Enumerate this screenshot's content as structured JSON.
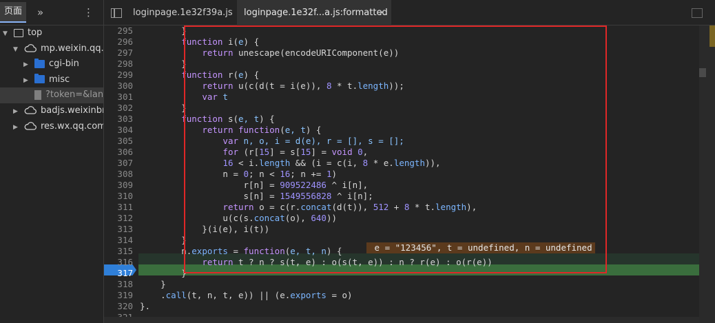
{
  "navigator": {
    "tab_label": "页面",
    "more_label": "»",
    "menu_label": "⋮",
    "tree": [
      {
        "label": "top",
        "icon": "frame-icon",
        "arrow": "▼",
        "indent": 0
      },
      {
        "label": "mp.weixin.qq.com",
        "icon": "cloud-icon",
        "arrow": "▼",
        "indent": 1
      },
      {
        "label": "cgi-bin",
        "icon": "folder-icon",
        "arrow": "▶",
        "indent": 2
      },
      {
        "label": "misc",
        "icon": "folder-icon",
        "arrow": "▶",
        "indent": 2
      },
      {
        "label": "?token=&lang",
        "icon": "file-icon",
        "arrow": "",
        "indent": 2,
        "selected": true
      },
      {
        "label": "badjs.weixinbridge",
        "icon": "cloud-icon",
        "arrow": "▶",
        "indent": 1
      },
      {
        "label": "res.wx.qq.com",
        "icon": "cloud-icon",
        "arrow": "▶",
        "indent": 1
      }
    ]
  },
  "editor_tabs": {
    "tab1": "loginpage.1e32f39a.js",
    "tab2": "loginpage.1e32f...a.js:formatted",
    "close": "×"
  },
  "code": {
    "inline_value": " e = \"123456\", t = undefined, n = undefined",
    "lines": [
      {
        "n": "295",
        "segs": [
          [
            "        }",
            "op"
          ]
        ]
      },
      {
        "n": "296",
        "segs": [
          [
            "        ",
            "op"
          ],
          [
            "function",
            "kw"
          ],
          [
            " i(",
            "fn"
          ],
          [
            "e",
            "var"
          ],
          [
            ") {",
            "op"
          ]
        ]
      },
      {
        "n": "297",
        "segs": [
          [
            "            ",
            "op"
          ],
          [
            "return",
            "kw"
          ],
          [
            " unescape(encodeURIComponent(e))",
            "fn"
          ]
        ]
      },
      {
        "n": "298",
        "segs": [
          [
            "        }",
            "op"
          ]
        ]
      },
      {
        "n": "299",
        "segs": [
          [
            "        ",
            "op"
          ],
          [
            "function",
            "kw"
          ],
          [
            " r(",
            "fn"
          ],
          [
            "e",
            "var"
          ],
          [
            ") {",
            "op"
          ]
        ]
      },
      {
        "n": "300",
        "segs": [
          [
            "            ",
            "op"
          ],
          [
            "return",
            "kw"
          ],
          [
            " u(c(d(t = i(e)), ",
            "fn"
          ],
          [
            "8",
            "num"
          ],
          [
            " * t.",
            "op"
          ],
          [
            "length",
            "prop"
          ],
          [
            "));",
            "op"
          ]
        ]
      },
      {
        "n": "301",
        "segs": [
          [
            "            ",
            "op"
          ],
          [
            "var",
            "kw"
          ],
          [
            " t",
            "var"
          ]
        ]
      },
      {
        "n": "302",
        "segs": [
          [
            "        }",
            "op"
          ]
        ]
      },
      {
        "n": "303",
        "segs": [
          [
            "        ",
            "op"
          ],
          [
            "function",
            "kw"
          ],
          [
            " s(",
            "fn"
          ],
          [
            "e, t",
            "var"
          ],
          [
            ") {",
            "op"
          ]
        ]
      },
      {
        "n": "304",
        "segs": [
          [
            "            ",
            "op"
          ],
          [
            "return",
            "kw"
          ],
          [
            " ",
            "op"
          ],
          [
            "function",
            "kw"
          ],
          [
            "(",
            "op"
          ],
          [
            "e, t",
            "var"
          ],
          [
            ") {",
            "op"
          ]
        ]
      },
      {
        "n": "305",
        "segs": [
          [
            "                ",
            "op"
          ],
          [
            "var",
            "kw"
          ],
          [
            " n, o, i = d(e), r = [], s = [];",
            "var"
          ]
        ]
      },
      {
        "n": "306",
        "segs": [
          [
            "                ",
            "op"
          ],
          [
            "for",
            "kw"
          ],
          [
            " (r[",
            "op"
          ],
          [
            "15",
            "num"
          ],
          [
            "] = s[",
            "op"
          ],
          [
            "15",
            "num"
          ],
          [
            "] = ",
            "op"
          ],
          [
            "void",
            "kw"
          ],
          [
            " ",
            "op"
          ],
          [
            "0",
            "num"
          ],
          [
            ",",
            "op"
          ]
        ]
      },
      {
        "n": "307",
        "segs": [
          [
            "                ",
            "op"
          ],
          [
            "16",
            "num"
          ],
          [
            " < i.",
            "op"
          ],
          [
            "length",
            "prop"
          ],
          [
            " && (i = c(i, ",
            "op"
          ],
          [
            "8",
            "num"
          ],
          [
            " * e.",
            "op"
          ],
          [
            "length",
            "prop"
          ],
          [
            ")),",
            "op"
          ]
        ]
      },
      {
        "n": "308",
        "segs": [
          [
            "                n = ",
            "op"
          ],
          [
            "0",
            "num"
          ],
          [
            "; n < ",
            "op"
          ],
          [
            "16",
            "num"
          ],
          [
            "; n += ",
            "op"
          ],
          [
            "1",
            "num"
          ],
          [
            ")",
            "op"
          ]
        ]
      },
      {
        "n": "309",
        "segs": [
          [
            "                    r[n] = ",
            "op"
          ],
          [
            "909522486",
            "num"
          ],
          [
            " ^ i[n],",
            "op"
          ]
        ]
      },
      {
        "n": "310",
        "segs": [
          [
            "                    s[n] = ",
            "op"
          ],
          [
            "1549556828",
            "num"
          ],
          [
            " ^ i[n];",
            "op"
          ]
        ]
      },
      {
        "n": "311",
        "segs": [
          [
            "                ",
            "op"
          ],
          [
            "return",
            "kw"
          ],
          [
            " o = c(r.",
            "op"
          ],
          [
            "concat",
            "prop"
          ],
          [
            "(d(t)), ",
            "op"
          ],
          [
            "512",
            "num"
          ],
          [
            " + ",
            "op"
          ],
          [
            "8",
            "num"
          ],
          [
            " * t.",
            "op"
          ],
          [
            "length",
            "prop"
          ],
          [
            "),",
            "op"
          ]
        ]
      },
      {
        "n": "312",
        "segs": [
          [
            "                u(c(s.",
            "op"
          ],
          [
            "concat",
            "prop"
          ],
          [
            "(o), ",
            "op"
          ],
          [
            "640",
            "num"
          ],
          [
            "))",
            "op"
          ]
        ]
      },
      {
        "n": "313",
        "segs": [
          [
            "            }(i(e), i(t))",
            "op"
          ]
        ]
      },
      {
        "n": "314",
        "segs": [
          [
            "        }",
            "op"
          ]
        ]
      },
      {
        "n": "315",
        "segs": [
          [
            "        n.",
            "op"
          ],
          [
            "exports",
            "prop"
          ],
          [
            " = ",
            "op"
          ],
          [
            "function",
            "kw"
          ],
          [
            "(",
            "op"
          ],
          [
            "e, t, n",
            "var"
          ],
          [
            ") {",
            "op"
          ]
        ]
      },
      {
        "n": "316",
        "segs": [
          [
            "            ",
            "op"
          ],
          [
            "return",
            "kw"
          ],
          [
            " t ? n ? s(t, e) : o(s(t, e)) : n ? r(e) : o(r(e))",
            "op"
          ]
        ]
      },
      {
        "n": "317",
        "segs": [
          [
            "        }",
            "op"
          ]
        ]
      },
      {
        "n": "318",
        "segs": [
          [
            "    }",
            "op"
          ]
        ]
      },
      {
        "n": "319",
        "segs": [
          [
            "    .",
            "op"
          ],
          [
            "call",
            "prop"
          ],
          [
            "(t, n, t, e)) || (e.",
            "op"
          ],
          [
            "exports",
            "prop"
          ],
          [
            " = o)",
            "op"
          ]
        ]
      },
      {
        "n": "320",
        "segs": [
          [
            "}.",
            "op"
          ]
        ]
      },
      {
        "n": "321",
        "segs": [
          [
            "",
            "op"
          ]
        ]
      }
    ]
  }
}
